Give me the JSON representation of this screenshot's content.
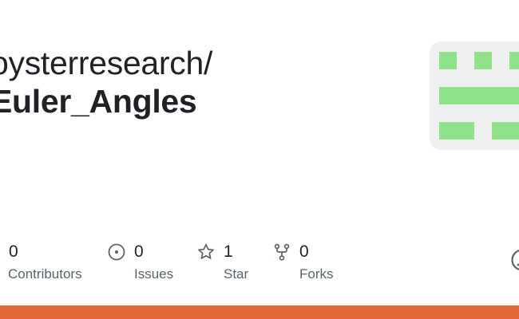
{
  "repo": {
    "owner": "oysterresearch/",
    "name": "Euler_Angles"
  },
  "stats": {
    "contributors": {
      "count": "0",
      "label": "Contributors"
    },
    "issues": {
      "count": "0",
      "label": "Issues"
    },
    "stars": {
      "count": "1",
      "label": "Star"
    },
    "forks": {
      "count": "0",
      "label": "Forks"
    }
  },
  "icons": {
    "issues": "issue-opened-icon",
    "stars": "star-icon",
    "forks": "repo-forked-icon",
    "edge": "github-mark-icon"
  },
  "colors": {
    "text": "#1f2328",
    "muted": "#59636e",
    "identicon_bg": "#f0f0f0",
    "identicon_fg": "#8fe38a",
    "language_bar": "#e16737"
  }
}
